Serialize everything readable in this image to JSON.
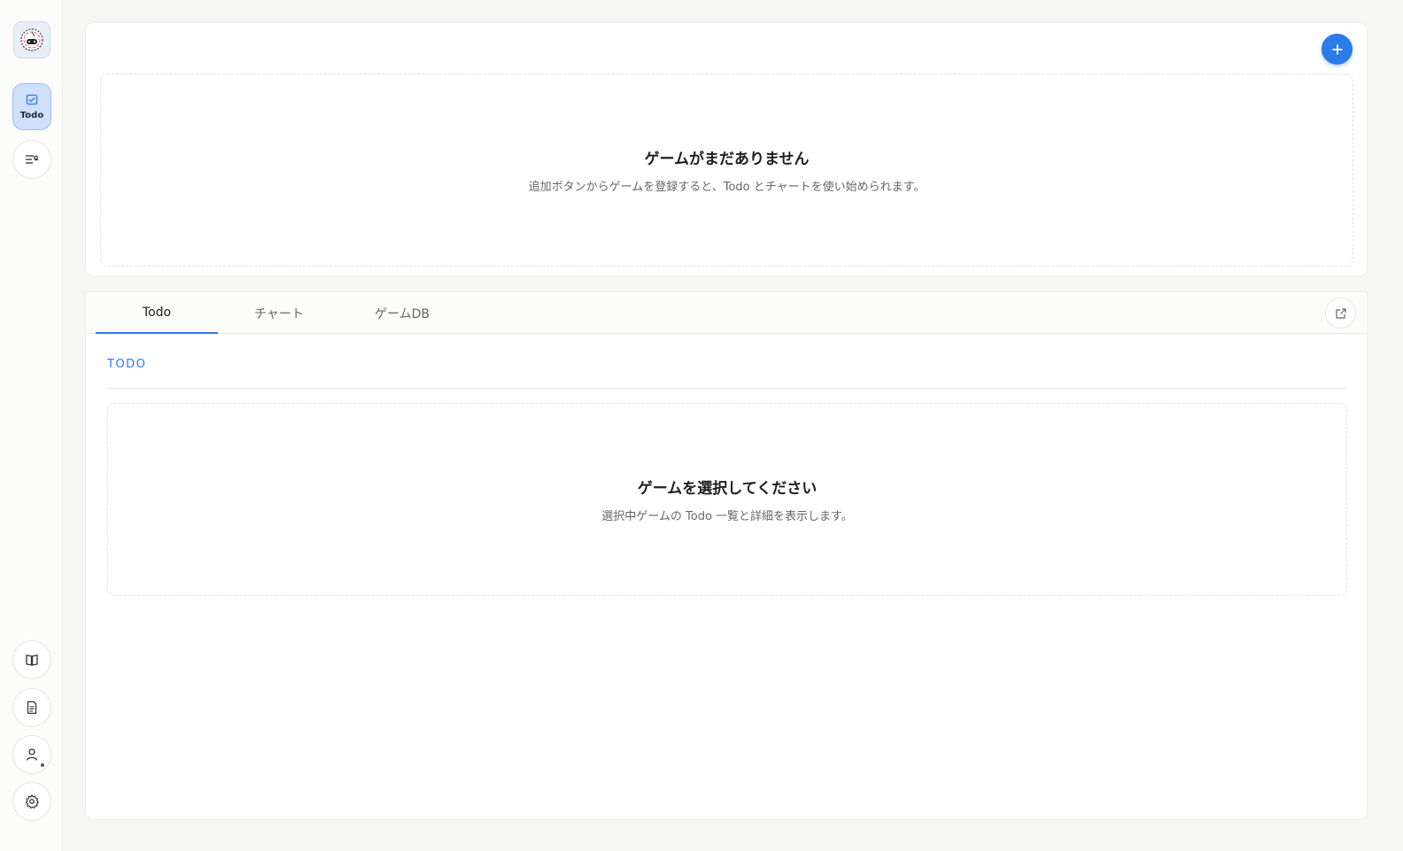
{
  "sidebar": {
    "logo_icon": "controller-dial-logo",
    "nav_todo": {
      "icon": "checkbox-icon",
      "label": "Todo"
    },
    "items": [
      {
        "name": "list-filter-icon"
      },
      {
        "name": "book-icon"
      },
      {
        "name": "document-icon"
      },
      {
        "name": "user-icon"
      },
      {
        "name": "gear-icon"
      }
    ]
  },
  "games_panel": {
    "add_button_icon": "plus-icon",
    "empty_title": "ゲームがまだありません",
    "empty_desc": "追加ボタンからゲームを登録すると、Todo とチャートを使い始められます。"
  },
  "tabs": [
    {
      "label": "Todo",
      "active": true
    },
    {
      "label": "チャート",
      "active": false
    },
    {
      "label": "ゲームDB",
      "active": false
    }
  ],
  "main": {
    "external_link_icon": "external-link-icon",
    "section_heading": "TODO",
    "empty_title": "ゲームを選択してください",
    "empty_desc": "選択中ゲームの Todo 一覧と詳細を表示します。"
  },
  "colors": {
    "accent": "#2b7be8",
    "sidebar_active_bg": "#cfe0fb"
  }
}
